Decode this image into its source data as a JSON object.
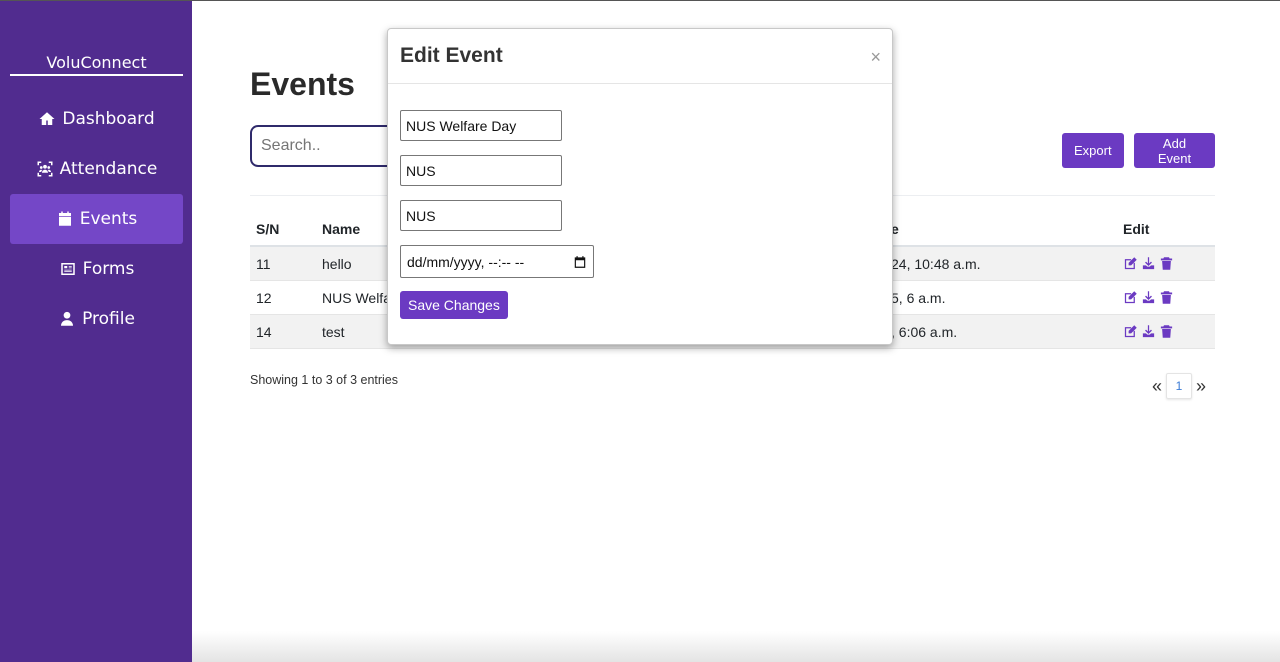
{
  "brand": "VoluConnect",
  "nav": [
    {
      "label": "Dashboard",
      "icon": "home-icon"
    },
    {
      "label": "Attendance",
      "icon": "people-scan-icon"
    },
    {
      "label": "Events",
      "icon": "calendar-icon",
      "active": true
    },
    {
      "label": "Forms",
      "icon": "form-icon"
    },
    {
      "label": "Profile",
      "icon": "user-icon"
    }
  ],
  "page": {
    "title": "Events",
    "search_placeholder": "Search..",
    "export_label": "Export",
    "add_label": "Add Event"
  },
  "table": {
    "headers": {
      "sn": "S/N",
      "name": "Name",
      "date": "e",
      "edit": "Edit"
    },
    "rows": [
      {
        "sn": "11",
        "name": "hello",
        "date": "24, 10:48 a.m."
      },
      {
        "sn": "12",
        "name": "NUS Welfare Day",
        "date": "5, 6 a.m."
      },
      {
        "sn": "14",
        "name": "test",
        "date": ", 6:06 a.m."
      }
    ]
  },
  "footer": {
    "info": "Showing 1 to 3 of 3 entries",
    "prev": "«",
    "page": "1",
    "next": "»"
  },
  "modal": {
    "title": "Edit Event",
    "close": "×",
    "field1": "NUS Welfare Day",
    "field2": "NUS",
    "field3": "NUS",
    "datetime": "dd/mm/yyyy, --:-- --",
    "save_label": "Save Changes"
  },
  "colors": {
    "sidebar": "#512c8f",
    "accent": "#6b3ac2",
    "active_nav": "#7447c7"
  }
}
